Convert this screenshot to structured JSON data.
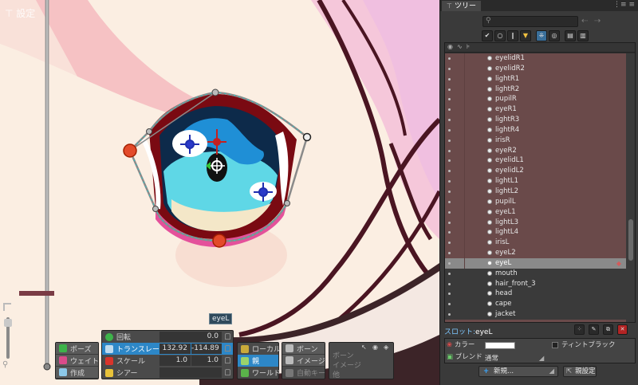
{
  "viewport": {
    "settings_label": "設定",
    "bone_label": "eyeL"
  },
  "toolbar": {
    "modes": [
      "ポーズ",
      "ウェイト",
      "作成"
    ],
    "transforms": {
      "rotate": {
        "label": "回転",
        "value": "0.0"
      },
      "translate": {
        "label": "トランスレート",
        "x": "132.92",
        "y": "-114.89"
      },
      "scale": {
        "label": "スケール",
        "x": "1.0",
        "y": "1.0"
      },
      "shear": {
        "label": "シアー",
        "value": ""
      }
    },
    "axes": [
      "ローカル",
      "親",
      "ワールド"
    ],
    "compensate": [
      "ボーン",
      "イメージ",
      "自動キー"
    ],
    "options_rows": [
      "ボーン",
      "イメージ",
      "他"
    ]
  },
  "tree": {
    "tab_label": "ツリー",
    "items": [
      {
        "label": "eyelidR1",
        "state": "normal"
      },
      {
        "label": "eyelidR2",
        "state": "normal"
      },
      {
        "label": "lightR1",
        "state": "normal"
      },
      {
        "label": "lightR2",
        "state": "normal"
      },
      {
        "label": "pupilR",
        "state": "normal"
      },
      {
        "label": "eyeR1",
        "state": "normal"
      },
      {
        "label": "lightR3",
        "state": "normal"
      },
      {
        "label": "lightR4",
        "state": "normal"
      },
      {
        "label": "irisR",
        "state": "normal"
      },
      {
        "label": "eyeR2",
        "state": "normal"
      },
      {
        "label": "eyelidL1",
        "state": "normal"
      },
      {
        "label": "eyelidL2",
        "state": "normal"
      },
      {
        "label": "lightL1",
        "state": "normal"
      },
      {
        "label": "lightL2",
        "state": "normal"
      },
      {
        "label": "pupilL",
        "state": "normal"
      },
      {
        "label": "eyeL1",
        "state": "normal"
      },
      {
        "label": "lightL3",
        "state": "normal"
      },
      {
        "label": "lightL4",
        "state": "normal"
      },
      {
        "label": "irisL",
        "state": "normal"
      },
      {
        "label": "eyeL2",
        "state": "normal"
      },
      {
        "label": "eyeL",
        "state": "selected"
      },
      {
        "label": "mouth",
        "state": "plain"
      },
      {
        "label": "hair_front_3",
        "state": "plain"
      },
      {
        "label": "head",
        "state": "plain"
      },
      {
        "label": "cape",
        "state": "plain"
      },
      {
        "label": "jacket",
        "state": "plain"
      }
    ]
  },
  "slot": {
    "title_prefix": "スロット:",
    "title_name": "eyeL",
    "color_label": "カラー",
    "tint_black_label": "ティントブラック",
    "blend_label": "ブレンド",
    "blend_value": "通常",
    "new_button": "新規...",
    "parent_button": "親設定"
  },
  "colors": {
    "accent": "#2d87c7",
    "tree_background": "#6a4a4a",
    "skin": "#fbeee2",
    "hair_pink": "#f3c6d8",
    "outline": "#4a1522"
  }
}
